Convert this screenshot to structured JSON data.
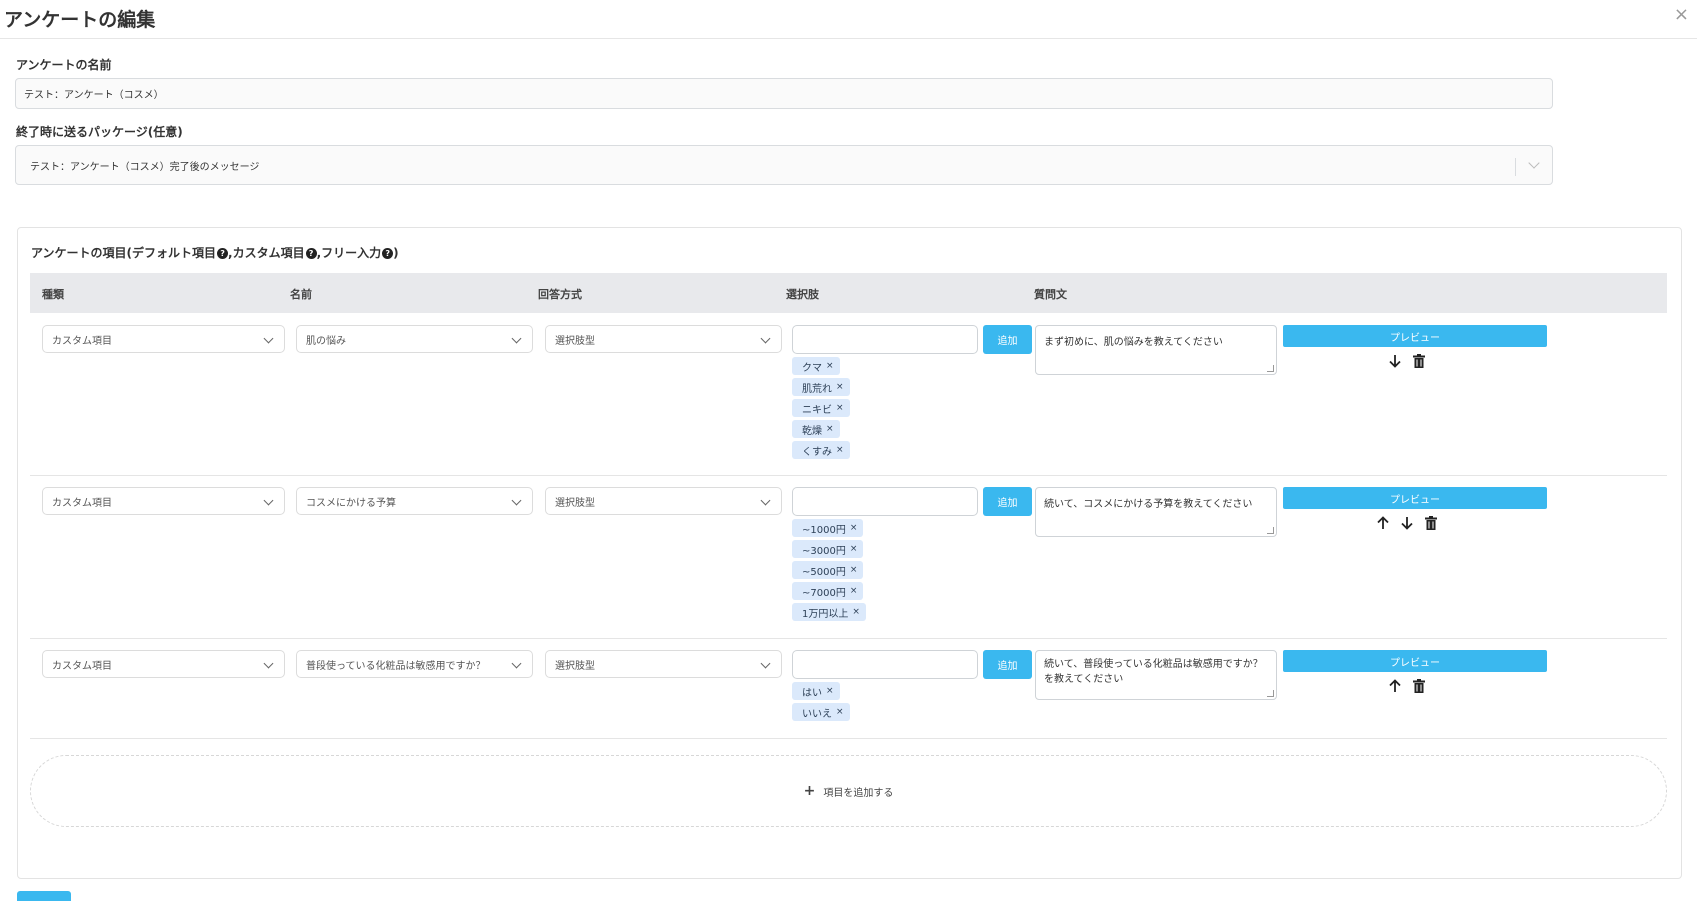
{
  "modal": {
    "title": "アンケートの編集",
    "close": "×"
  },
  "survey_name": {
    "label": "アンケートの名前",
    "value": "テスト：アンケート（コスメ）"
  },
  "end_package": {
    "label": "終了時に送るパッケージ(任意)",
    "value": "テスト：アンケート（コスメ）完了後のメッセージ"
  },
  "items_panel": {
    "title_prefix": "アンケートの項目(デフォルト項目",
    "title_mid1": ",カスタム項目",
    "title_mid2": ",フリー入力",
    "title_suffix": ")",
    "help_glyph": "?",
    "columns": [
      "種類",
      "名前",
      "回答方式",
      "選択肢",
      "質問文"
    ],
    "rows": [
      {
        "type": "カスタム項目",
        "name": "肌の悩み",
        "answer_method": "選択肢型",
        "add_label": "追加",
        "options": [
          "クマ",
          "肌荒れ",
          "ニキビ",
          "乾燥",
          "くすみ"
        ],
        "question": "まず初めに、肌の悩みを教えてください",
        "preview_label": "プレビュー",
        "actions": [
          "arrow-down-icon",
          "trash-icon"
        ]
      },
      {
        "type": "カスタム項目",
        "name": "コスメにかける予算",
        "answer_method": "選択肢型",
        "add_label": "追加",
        "options": [
          "~1000円",
          "~3000円",
          "~5000円",
          "~7000円",
          "1万円以上"
        ],
        "question": "続いて、コスメにかける予算を教えてください",
        "preview_label": "プレビュー",
        "actions": [
          "arrow-up-icon",
          "arrow-down-icon",
          "trash-icon"
        ]
      },
      {
        "type": "カスタム項目",
        "name": "普段使っている化粧品は敏感用ですか？",
        "answer_method": "選択肢型",
        "add_label": "追加",
        "options": [
          "はい",
          "いいえ"
        ],
        "question": "続いて、普段使っている化粧品は敏感用ですか？を教えてください",
        "preview_label": "プレビュー",
        "actions": [
          "arrow-up-icon",
          "trash-icon"
        ]
      }
    ],
    "tag_remove": "×",
    "add_item_label": "項目を追加する",
    "add_item_icon": "+"
  },
  "colors": {
    "accent": "#3ab8ef",
    "tag_bg": "#dbe9fb",
    "header_bg": "#e8e9ec"
  }
}
